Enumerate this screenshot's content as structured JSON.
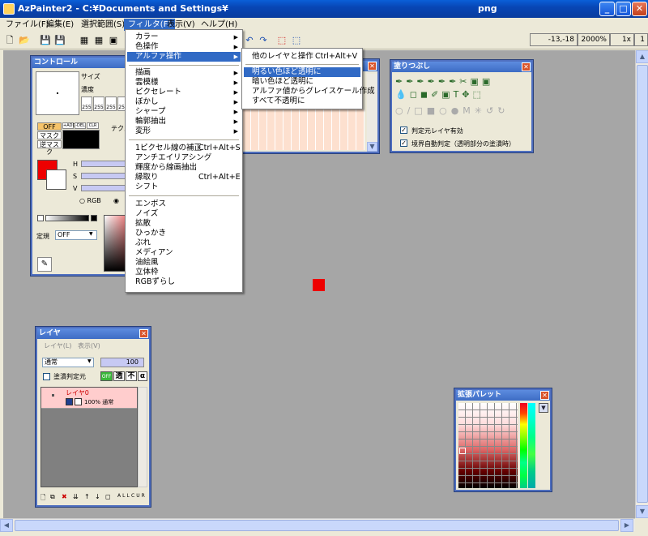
{
  "window": {
    "title": "AzPainter2 - C:¥Documents and Settings¥",
    "ext": "png",
    "min": "_",
    "max": "□",
    "close": "✕"
  },
  "menubar": [
    "ファイル(F)",
    "編集(E)",
    "選択範囲(S)",
    "フィルタ(F)",
    "表示(V)",
    "ヘルプ(H)"
  ],
  "status": {
    "coords": "-13,-18",
    "zoom": "2000%",
    "scale": "1x",
    "page": "1"
  },
  "filter_menu": {
    "group1": [
      {
        "label": "カラー",
        "sub": true
      },
      {
        "label": "色操作",
        "sub": true
      },
      {
        "label": "アルファ操作",
        "sub": true
      }
    ],
    "group2": [
      {
        "label": "描画",
        "sub": true
      },
      {
        "label": "雲模様",
        "sub": true
      },
      {
        "label": "ピクセレート",
        "sub": true
      },
      {
        "label": "ぼかし",
        "sub": true
      },
      {
        "label": "シャープ",
        "sub": true
      },
      {
        "label": "輪郭抽出",
        "sub": true
      },
      {
        "label": "変形",
        "sub": true
      }
    ],
    "group3": [
      {
        "label": "1ピクセル線の補正",
        "shortcut": "Ctrl+Alt+S"
      },
      {
        "label": "アンチエイリアシング",
        "shortcut": ""
      },
      {
        "label": "輝度から線画抽出",
        "shortcut": ""
      },
      {
        "label": "縁取り",
        "shortcut": "Ctrl+Alt+E"
      },
      {
        "label": "シフト",
        "shortcut": ""
      }
    ],
    "group4": [
      "エンボス",
      "ノイズ",
      "拡散",
      "ひっかき",
      "ぶれ",
      "メディアン",
      "油絵風",
      "立体枠",
      "RGBずらし"
    ]
  },
  "alpha_submenu": [
    {
      "label": "他のレイヤと操作",
      "shortcut": "Ctrl+Alt+V"
    },
    {
      "label": "明るい色ほど透明に",
      "shortcut": ""
    },
    {
      "label": "暗い色ほど透明に",
      "shortcut": ""
    },
    {
      "label": "アルファ値からグレイスケール作成",
      "shortcut": ""
    },
    {
      "label": "すべて不透明に",
      "shortcut": ""
    }
  ],
  "control_panel": {
    "title": "コントロール",
    "size_label": "サイズ",
    "density_label": "濃度",
    "rgb_values": [
      "255",
      "255",
      "255",
      "255"
    ],
    "off_label": "OFF",
    "mask_label": "マスク",
    "reverse_mask_label": "逆マスク",
    "texture_label": "テクス",
    "h_label": "H",
    "s_label": "S",
    "v_label": "V",
    "rgb_label": "RGB",
    "ruler_label": "定規",
    "ruler_value": "OFF",
    "mode_buttons": [
      "+ADD",
      "-DEL",
      "CLR"
    ]
  },
  "fill_panel": {
    "title": "塗りつぶし",
    "check1": "判定元レイヤ有効",
    "check2": "境界自動判定（透明部分の塗潰時）"
  },
  "layer_panel": {
    "title": "レイヤ",
    "menu_layer": "レイヤ(L)",
    "menu_view": "表示(V)",
    "blend_mode": "通常",
    "opacity": "100",
    "fill_source": "塗潰判定元",
    "off_btn": "OFF",
    "trans_btn": "透",
    "opaque_btn": "不",
    "alpha_btn": "α",
    "layer_name": "レイヤ0",
    "layer_info": "100% 通常",
    "bottom_buttons": [
      "ALL",
      "CUR"
    ]
  },
  "palette_panel": {
    "title": "拡張パレット"
  },
  "colors": {
    "accent": "#316ac5",
    "red": "#ee0000",
    "canvas": "#a6a6a6"
  }
}
